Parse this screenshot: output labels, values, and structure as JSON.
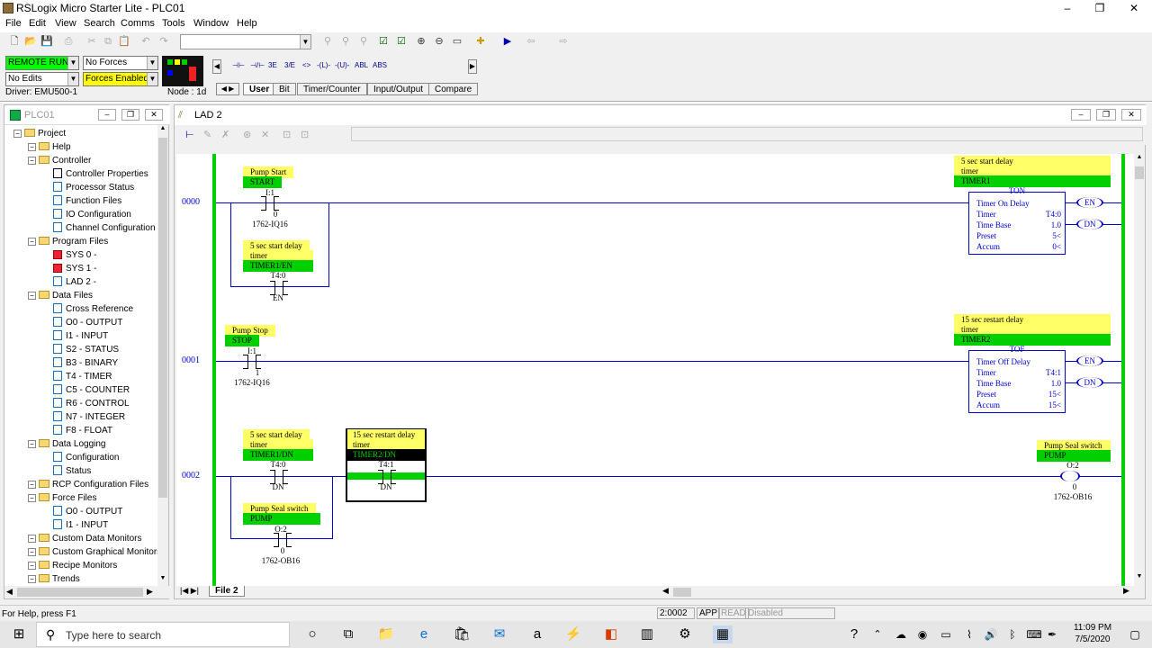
{
  "window": {
    "title": "RSLogix Micro Starter Lite - PLC01",
    "min": "–",
    "max": "❐",
    "close": "✕"
  },
  "menu": [
    "File",
    "Edit",
    "View",
    "Search",
    "Comms",
    "Tools",
    "Window",
    "Help"
  ],
  "status": {
    "mode": "REMOTE RUN",
    "forces": "No Forces",
    "edits": "No Edits",
    "forces_enabled": "Forces Enabled",
    "driver": "Driver: EMU500-1",
    "node": "Node : 1d"
  },
  "instruction_tabs": [
    "User",
    "Bit",
    "Timer/Counter",
    "Input/Output",
    "Compare"
  ],
  "instruction_buttons": [
    "⊣⊢",
    "⊣/⊢",
    "3E",
    "3/E",
    "<>",
    "-(L)-",
    "-(U)-",
    "ABL",
    "ABS"
  ],
  "project": {
    "title": "PLC01",
    "items": [
      {
        "label": "Project",
        "level": 0,
        "icon": "folder"
      },
      {
        "label": "Help",
        "level": 1,
        "icon": "folder"
      },
      {
        "label": "Controller",
        "level": 1,
        "icon": "folder"
      },
      {
        "label": "Controller Properties",
        "level": 2,
        "icon": "info"
      },
      {
        "label": "Processor Status",
        "level": 2,
        "icon": "doc"
      },
      {
        "label": "Function Files",
        "level": 2,
        "icon": "doc"
      },
      {
        "label": "IO Configuration",
        "level": 2,
        "icon": "doc"
      },
      {
        "label": "Channel Configuration",
        "level": 2,
        "icon": "doc"
      },
      {
        "label": "Program Files",
        "level": 1,
        "icon": "folder"
      },
      {
        "label": "SYS 0 -",
        "level": 2,
        "icon": "red"
      },
      {
        "label": "SYS 1 -",
        "level": 2,
        "icon": "red"
      },
      {
        "label": "LAD 2 -",
        "level": 2,
        "icon": "doc"
      },
      {
        "label": "Data Files",
        "level": 1,
        "icon": "folder"
      },
      {
        "label": "Cross Reference",
        "level": 2,
        "icon": "doc"
      },
      {
        "label": "O0 - OUTPUT",
        "level": 2,
        "icon": "doc"
      },
      {
        "label": "I1 - INPUT",
        "level": 2,
        "icon": "doc"
      },
      {
        "label": "S2 - STATUS",
        "level": 2,
        "icon": "doc"
      },
      {
        "label": "B3 - BINARY",
        "level": 2,
        "icon": "doc"
      },
      {
        "label": "T4 - TIMER",
        "level": 2,
        "icon": "doc"
      },
      {
        "label": "C5 - COUNTER",
        "level": 2,
        "icon": "doc"
      },
      {
        "label": "R6 - CONTROL",
        "level": 2,
        "icon": "doc"
      },
      {
        "label": "N7 - INTEGER",
        "level": 2,
        "icon": "doc"
      },
      {
        "label": "F8 - FLOAT",
        "level": 2,
        "icon": "doc"
      },
      {
        "label": "Data Logging",
        "level": 1,
        "icon": "folder"
      },
      {
        "label": "Configuration",
        "level": 2,
        "icon": "doc"
      },
      {
        "label": "Status",
        "level": 2,
        "icon": "doc"
      },
      {
        "label": "RCP Configuration Files",
        "level": 1,
        "icon": "folder"
      },
      {
        "label": "Force Files",
        "level": 1,
        "icon": "folder"
      },
      {
        "label": "O0 - OUTPUT",
        "level": 2,
        "icon": "doc"
      },
      {
        "label": "I1 - INPUT",
        "level": 2,
        "icon": "doc"
      },
      {
        "label": "Custom Data Monitors",
        "level": 1,
        "icon": "folder"
      },
      {
        "label": "Custom Graphical Monitors",
        "level": 1,
        "icon": "folder"
      },
      {
        "label": "Recipe Monitors",
        "level": 1,
        "icon": "folder"
      },
      {
        "label": "Trends",
        "level": 1,
        "icon": "folder"
      }
    ]
  },
  "lad": {
    "title": "LAD 2",
    "file_tab": "File 2",
    "rungs": [
      "0000",
      "0001",
      "0002"
    ],
    "r0": {
      "c1_cmt": "Pump Start",
      "c1_sym": "START",
      "c1_addr": "I:1",
      "c1_bit": "0",
      "c1_mod": "1762-IQ16",
      "c2_cmt1": "5 sec start delay",
      "c2_cmt2": "timer",
      "c2_sym": "TIMER1/EN",
      "c2_addr": "T4:0",
      "c2_bit": "EN",
      "t_cmt1": "5 sec start delay",
      "t_cmt2": "timer",
      "t_sym": "TIMER1",
      "t_hd": "TON",
      "t_name": "Timer On Delay",
      "t_l1": "Timer",
      "t_v1": "T4:0",
      "t_l2": "Time Base",
      "t_v2": "1.0",
      "t_l3": "Preset",
      "t_v3": "5<",
      "t_l4": "Accum",
      "t_v4": "0<",
      "en": "EN",
      "dn": "DN"
    },
    "r1": {
      "c1_cmt": "Pump Stop",
      "c1_sym": "STOP",
      "c1_addr": "I:1",
      "c1_bit": "1",
      "c1_mod": "1762-IQ16",
      "t_cmt1": "15 sec restart delay",
      "t_cmt2": "timer",
      "t_sym": "TIMER2",
      "t_hd": "TOF",
      "t_name": "Timer Off Delay",
      "t_l1": "Timer",
      "t_v1": "T4:1",
      "t_l2": "Time Base",
      "t_v2": "1.0",
      "t_l3": "Preset",
      "t_v3": "15<",
      "t_l4": "Accum",
      "t_v4": "15<",
      "en": "EN",
      "dn": "DN"
    },
    "r2": {
      "c1_cmt1": "5 sec start delay",
      "c1_cmt2": "timer",
      "c1_sym": "TIMER1/DN",
      "c1_addr": "T4:0",
      "c1_bit": "DN",
      "c2_cmt1": "15 sec restart delay",
      "c2_cmt2": "timer",
      "c2_sym": "TIMER2/DN",
      "c2_addr": "T4:1",
      "c2_bit": "DN",
      "c3_cmt": "Pump Seal switch",
      "c3_sym": "PUMP",
      "c3_addr": "O:2",
      "c3_bit": "0",
      "c3_mod": "1762-OB16",
      "o_cmt": "Pump Seal switch",
      "o_sym": "PUMP",
      "o_addr": "O:2",
      "o_bit": "0",
      "o_mod": "1762-OB16"
    }
  },
  "statusbar": {
    "help": "For Help, press F1",
    "pos": "2:0002",
    "app": "APP",
    "read": "READ",
    "disabled": "Disabled"
  },
  "taskbar": {
    "search": "Type here to search",
    "time": "11:09 PM",
    "date": "7/5/2020"
  }
}
